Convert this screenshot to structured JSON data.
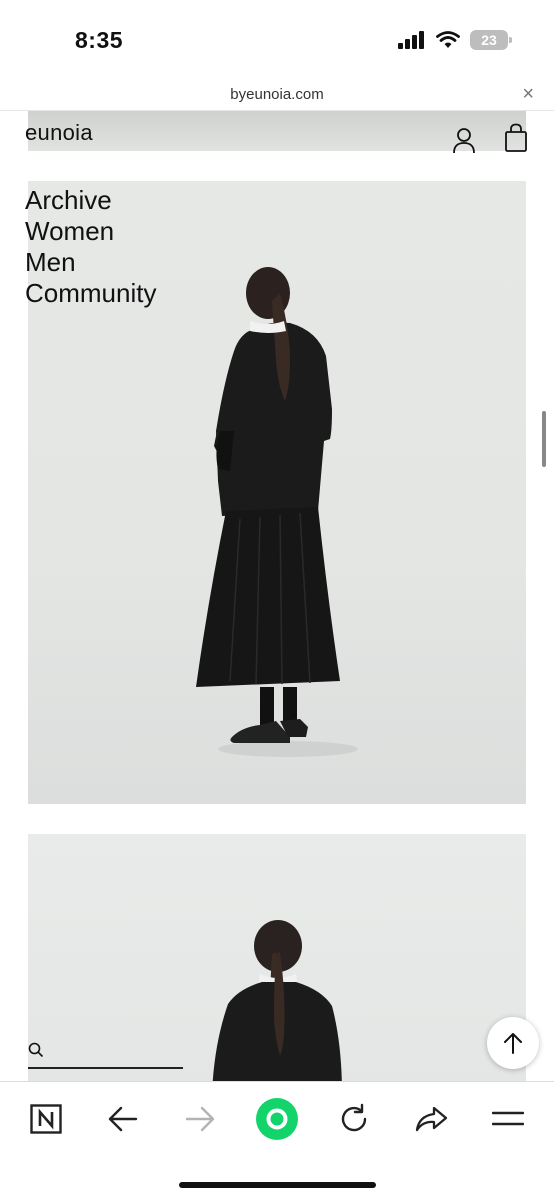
{
  "status_bar": {
    "time": "8:35",
    "battery": "23"
  },
  "browser": {
    "url": "byeunoia.com",
    "close_glyph": "×"
  },
  "site": {
    "brand": "eunoia",
    "nav": [
      "Archive",
      "Women",
      "Men",
      "Community"
    ],
    "search_placeholder": ""
  },
  "icons": {
    "status": [
      "cellular-signal-icon",
      "wifi-icon",
      "battery-icon"
    ],
    "header": [
      "account-icon",
      "shopping-bag-icon"
    ],
    "page": [
      "search-icon",
      "arrow-up-icon"
    ],
    "toolbar": [
      "naver-n-icon",
      "back-arrow-icon",
      "forward-arrow-icon",
      "green-circle-icon",
      "refresh-icon",
      "share-icon",
      "menu-icon"
    ]
  },
  "colors": {
    "accent_green": "#13d46a",
    "disabled_gray": "#b3b3b3",
    "text": "#111111"
  }
}
